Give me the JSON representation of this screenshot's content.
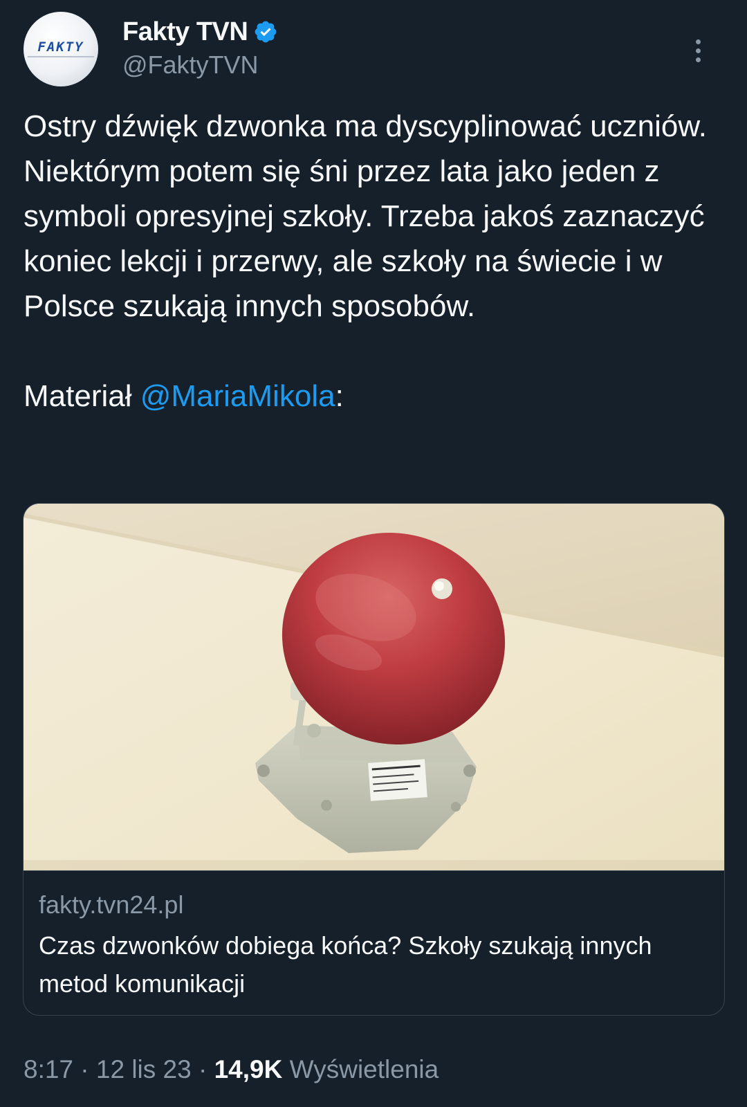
{
  "author": {
    "avatar_text": "FAKTY",
    "display_name": "Fakty TVN",
    "handle": "@FaktyTVN",
    "verified": true
  },
  "icons": {
    "verified": "verified-badge-icon",
    "more": "more-vertical-icon"
  },
  "tweet": {
    "paragraph_1": "Ostry dźwięk dzwonka ma dyscyplinować uczniów. Niektórym potem się śni przez lata jako jeden z symboli opresyjnej szkoły. Trzeba jakoś zaznaczyć koniec lekcji i przerwy, ale szkoły na świecie i w Polsce szukają innych sposobów.",
    "paragraph_2_prefix": "Materiał ",
    "mention": "@MariaMikola",
    "paragraph_2_suffix": ":"
  },
  "link_card": {
    "image": {
      "label_lines": [
        "DZWONEK SZKOLNY",
        "DNS-340",
        "220V~ 25VA"
      ]
    },
    "domain": "fakty.tvn24.pl",
    "title": "Czas dzwonków dobiega końca? Szkoły szukają innych metod komunikacji"
  },
  "meta": {
    "time": "8:17",
    "separator": " · ",
    "date": "12 lis 23",
    "views_count": "14,9K",
    "views_label": " Wyświetlenia"
  },
  "colors": {
    "background": "#15202b",
    "text": "#f7f9f9",
    "secondary_text": "#8b98a5",
    "accent": "#1d9bf0",
    "border": "#38444d"
  }
}
